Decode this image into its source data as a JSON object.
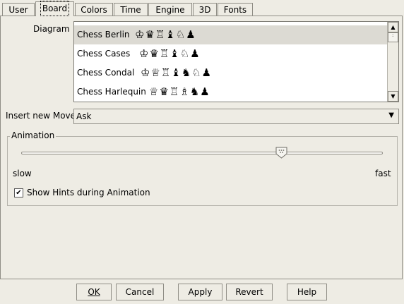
{
  "tabs": [
    {
      "label": "User"
    },
    {
      "label": "Board",
      "selected": true
    },
    {
      "label": "Colors"
    },
    {
      "label": "Time"
    },
    {
      "label": "Engine"
    },
    {
      "label": "3D"
    },
    {
      "label": "Fonts"
    }
  ],
  "diagram": {
    "label": "Diagram",
    "items": [
      {
        "name": "Chess Berlin",
        "pieces": "♔♛♖♝♘♟",
        "selected": true
      },
      {
        "name": "Chess Cases",
        "pieces": "♔♛♖♝♘♟"
      },
      {
        "name": "Chess Condal",
        "pieces": "♔♕♖♝♞♘♟"
      },
      {
        "name": "Chess Harlequin",
        "pieces": "♕♛♖♗♞♟"
      }
    ]
  },
  "insert_move": {
    "label": "Insert new Move",
    "value": "Ask"
  },
  "animation": {
    "title": "Animation",
    "slow_label": "slow",
    "fast_label": "fast",
    "level": 0.72,
    "show_hints_label": "Show Hints during Animation",
    "show_hints_checked": true
  },
  "buttons": {
    "ok": "OK",
    "cancel": "Cancel",
    "apply": "Apply",
    "revert": "Revert",
    "help": "Help"
  },
  "colors": {
    "background": "#eeece4",
    "selection": "#dcdad3"
  }
}
